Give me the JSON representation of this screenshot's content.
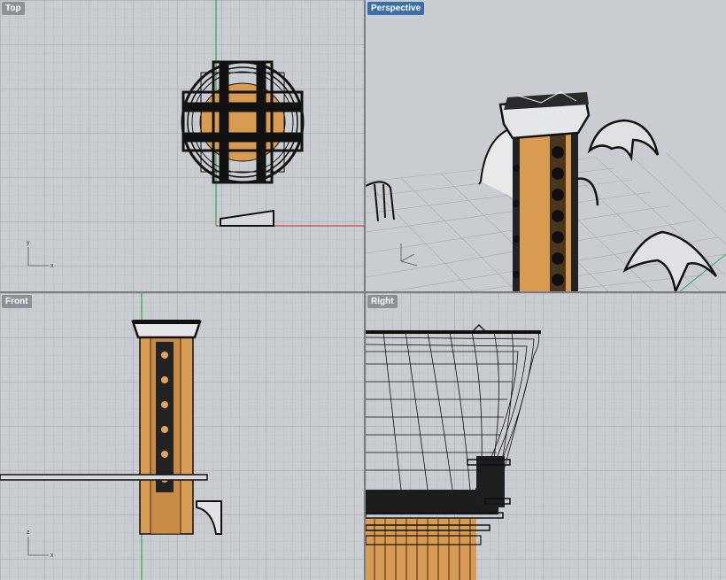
{
  "viewports": {
    "top": {
      "label": "Top"
    },
    "perspective": {
      "label": "Perspective",
      "active": true
    },
    "front": {
      "label": "Front"
    },
    "right": {
      "label": "Right"
    }
  },
  "axes": {
    "x": "x",
    "y": "y",
    "z": "z"
  },
  "colors": {
    "viewport_bg": "#c9ccd0",
    "grid_minor": "#b3b7bc",
    "grid_major": "#9ea3a9",
    "axis_x": "#d04040",
    "axis_y": "#2fa84f",
    "wood": "#d99a52",
    "wireframe": "#111111",
    "active_label": "#3b6fa8"
  }
}
